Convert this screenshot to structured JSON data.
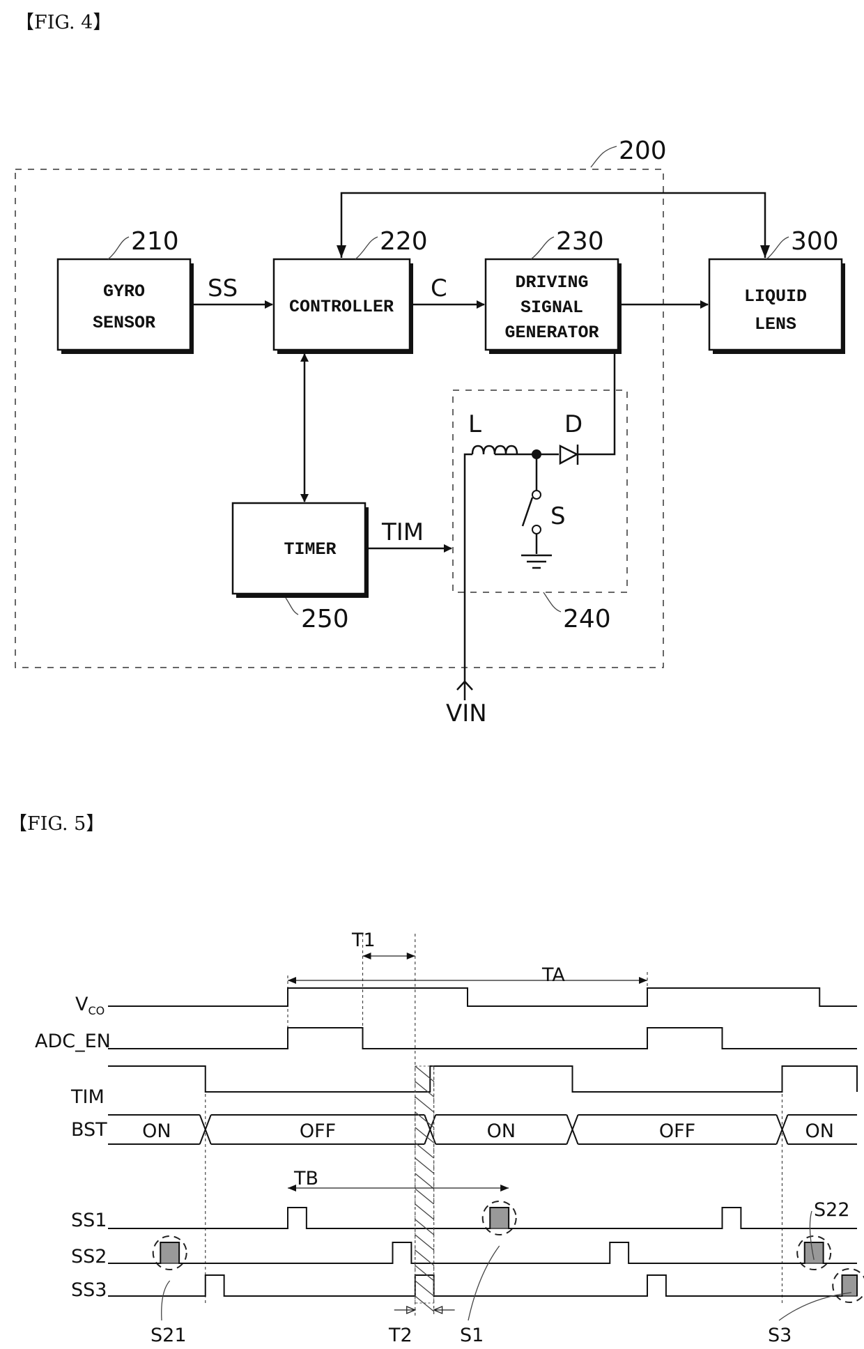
{
  "fig4": {
    "label": "【FIG. 4】",
    "refs": {
      "module": "200",
      "gyro": "210",
      "controller": "220",
      "driver": "230",
      "booster": "240",
      "timer": "250",
      "lens": "300"
    },
    "blocks": {
      "gyro": [
        "GYRO",
        "SENSOR"
      ],
      "controller": [
        "CONTROLLER"
      ],
      "driver": [
        "DRIVING",
        "SIGNAL",
        "GENERATOR"
      ],
      "lens": [
        "LIQUID",
        "LENS"
      ],
      "timer": [
        "TIMER"
      ]
    },
    "signals": {
      "ss": "SS",
      "c": "C",
      "tim": "TIM",
      "vin": "VIN"
    },
    "components": {
      "inductor": "L",
      "diode": "D",
      "switch": "S"
    }
  },
  "fig5": {
    "label": "【FIG. 5】",
    "signal_labels": [
      "V",
      "ADC_EN",
      "TIM",
      "BST",
      "SS1",
      "SS2",
      "SS3"
    ],
    "vco_sub": "CO",
    "intervals": {
      "t1": "T1",
      "ta": "TA",
      "tb": "TB",
      "t2": "T2"
    },
    "bst_states": [
      "ON",
      "OFF",
      "ON",
      "OFF",
      "ON"
    ],
    "markers": {
      "s21": "S21",
      "s1": "S1",
      "s22": "S22",
      "s3": "S3"
    }
  },
  "chart_data": {
    "type": "timing",
    "title": "FIG. 5",
    "time_units": "relative (0-100 across plot width)",
    "signals": [
      {
        "name": "VCO",
        "transitions": [
          [
            0,
            0
          ],
          [
            24,
            1
          ],
          [
            48,
            0
          ],
          [
            72,
            1
          ],
          [
            95,
            0
          ]
        ]
      },
      {
        "name": "ADC_EN",
        "transitions": [
          [
            0,
            0
          ],
          [
            24,
            1
          ],
          [
            34,
            0
          ],
          [
            72,
            1
          ],
          [
            82,
            0
          ]
        ]
      },
      {
        "name": "TIM",
        "transitions": [
          [
            0,
            1
          ],
          [
            13,
            0
          ],
          [
            43,
            1
          ],
          [
            62,
            0
          ],
          [
            90,
            1
          ],
          [
            110,
            0
          ]
        ]
      },
      {
        "name": "BST",
        "states": [
          [
            "ON",
            0,
            13
          ],
          [
            "OFF",
            13,
            43
          ],
          [
            "ON",
            43,
            62
          ],
          [
            "OFF",
            62,
            90
          ],
          [
            "ON",
            90,
            108
          ]
        ]
      },
      {
        "name": "SS1",
        "pulses": [
          [
            24,
            26.5
          ],
          [
            51,
            53.5,
            "S1"
          ],
          [
            82,
            84.5
          ]
        ]
      },
      {
        "name": "SS2",
        "pulses": [
          [
            7,
            9.5,
            "S21"
          ],
          [
            38,
            40.5
          ],
          [
            67,
            69.5
          ],
          [
            93,
            95.5,
            "S22"
          ]
        ]
      },
      {
        "name": "SS3",
        "pulses": [
          [
            13,
            15.5
          ],
          [
            41,
            43.5,
            "T2-hatched"
          ],
          [
            72,
            74.5
          ],
          [
            98,
            100.5,
            "S3"
          ]
        ]
      }
    ],
    "intervals": [
      {
        "name": "T1",
        "from": 34,
        "to": 41
      },
      {
        "name": "TA",
        "from": 24,
        "to": 72
      },
      {
        "name": "TB",
        "from": 24,
        "to": 53.5
      },
      {
        "name": "T2",
        "from": 41,
        "to": 43.5
      }
    ]
  }
}
